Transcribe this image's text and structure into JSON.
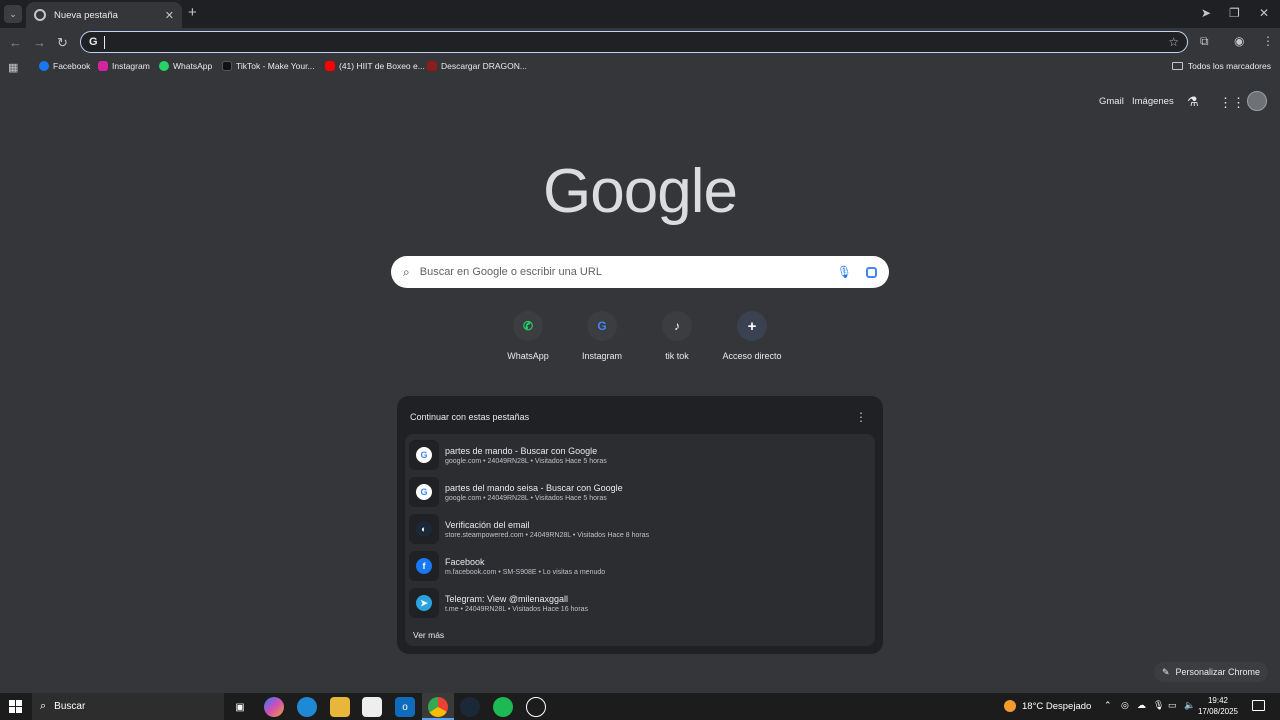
{
  "browser": {
    "tab_title": "Nueva pestaña",
    "omnibox_value": "",
    "bookmarks": [
      {
        "label": "Facebook",
        "color": "#1877f2"
      },
      {
        "label": "Instagram",
        "color": "#d6249f"
      },
      {
        "label": "WhatsApp",
        "color": "#25d366"
      },
      {
        "label": "TikTok - Make Your...",
        "color": "#111111"
      },
      {
        "label": "(41) HIIT de Boxeo e...",
        "color": "#ff0000"
      },
      {
        "label": "Descargar DRAGON...",
        "color": "#8b1d1d"
      }
    ],
    "all_bookmarks_label": "Todos los marcadores"
  },
  "header": {
    "gmail": "Gmail",
    "images": "Imágenes"
  },
  "logo_text": "Google",
  "search": {
    "placeholder": "Buscar en Google o escribir una URL"
  },
  "shortcuts": [
    {
      "label": "WhatsApp",
      "icon": "whatsapp-icon",
      "glyph": "✆",
      "color": "#25d366"
    },
    {
      "label": "Instagram",
      "icon": "google-icon",
      "glyph": "G",
      "color": "#4285f4"
    },
    {
      "label": "tik tok",
      "icon": "tiktok-icon",
      "glyph": "♪",
      "color": "#ffffff"
    },
    {
      "label": "Acceso directo",
      "icon": "plus-icon",
      "glyph": "+",
      "color": "#ffffff"
    }
  ],
  "continue_card": {
    "title": "Continuar con estas pestañas",
    "items": [
      {
        "title": "partes de mando - Buscar con Google",
        "meta": "google.com • 24049RN28L • Visitados Hace 5 horas",
        "icon": "google-icon",
        "glyph": "G",
        "color": "#ffffff",
        "fg": "#4285f4"
      },
      {
        "title": "partes del mando seisa - Buscar con Google",
        "meta": "google.com • 24049RN28L • Visitados Hace 5 horas",
        "icon": "google-icon",
        "glyph": "G",
        "color": "#ffffff",
        "fg": "#4285f4"
      },
      {
        "title": "Verificación del email",
        "meta": "store.steampowered.com • 24049RN28L • Visitados Hace 8 horas",
        "icon": "steam-icon",
        "glyph": "◐",
        "color": "#1b2838",
        "fg": "#ffffff"
      },
      {
        "title": "Facebook",
        "meta": "m.facebook.com • SM-S908E • Lo visitas a menudo",
        "icon": "facebook-icon",
        "glyph": "f",
        "color": "#1877f2",
        "fg": "#ffffff"
      },
      {
        "title": "Telegram: View @milenaxggall",
        "meta": "t.me • 24049RN28L • Visitados Hace 16 horas",
        "icon": "telegram-icon",
        "glyph": "➤",
        "color": "#2aa3df",
        "fg": "#ffffff"
      }
    ],
    "see_more": "Ver más"
  },
  "customize_label": "Personalizar Chrome",
  "taskbar": {
    "search_label": "Buscar",
    "weather": "18°C  Despejado",
    "time": "19:42",
    "date": "17/08/2025"
  }
}
